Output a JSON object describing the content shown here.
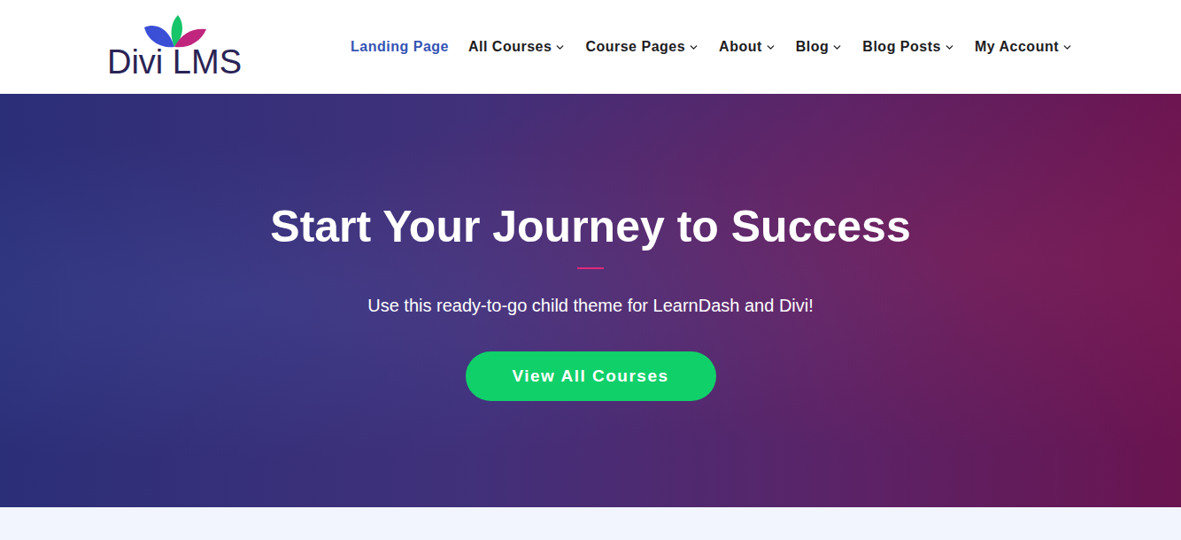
{
  "logo": {
    "text": "Divi LMS"
  },
  "nav": [
    {
      "label": "Landing Page",
      "selected": true,
      "dropdown": false
    },
    {
      "label": "All Courses",
      "selected": false,
      "dropdown": true
    },
    {
      "label": "Course Pages",
      "selected": false,
      "dropdown": true
    },
    {
      "label": "About",
      "selected": false,
      "dropdown": true
    },
    {
      "label": "Blog",
      "selected": false,
      "dropdown": true
    },
    {
      "label": "Blog Posts",
      "selected": false,
      "dropdown": true
    },
    {
      "label": "My Account",
      "selected": false,
      "dropdown": true
    }
  ],
  "hero": {
    "title": "Start Your Journey to Success",
    "subtitle": "Use this ready-to-go child theme for LearnDash and Divi!",
    "button": "View All Courses"
  }
}
